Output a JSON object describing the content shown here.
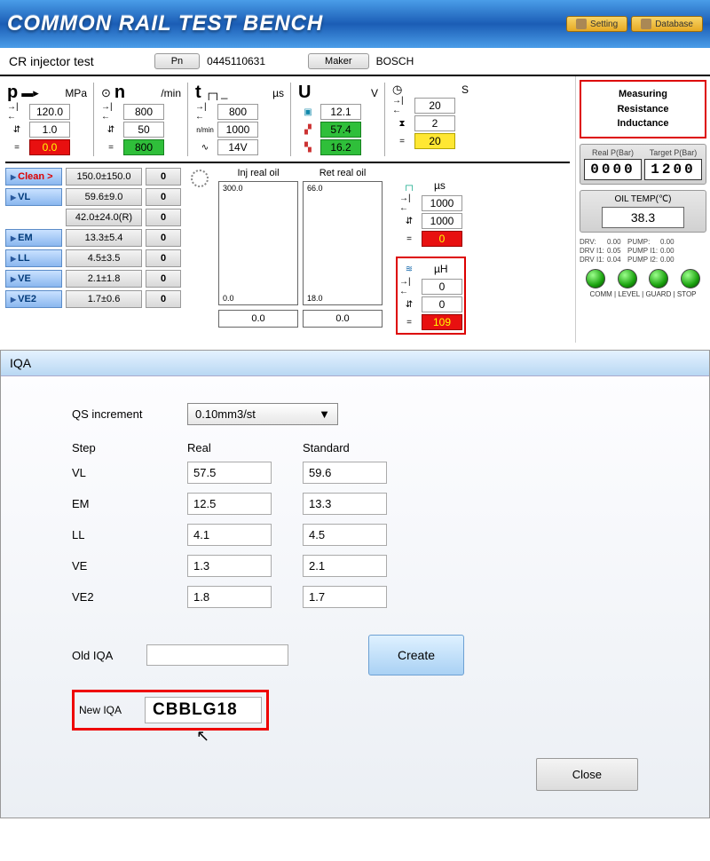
{
  "topbar": {
    "title": "COMMON RAIL TEST BENCH",
    "setting": "Setting",
    "database": "Database"
  },
  "sub": {
    "title": "CR injector test",
    "pn_label": "Pn",
    "pn_value": "0445110631",
    "maker_label": "Maker",
    "maker_value": "BOSCH"
  },
  "p": {
    "sym": "p",
    "unit": "MPa",
    "r1": "120.0",
    "r2": "1.0",
    "r3": "0.0"
  },
  "n": {
    "sym": "n",
    "unit": "/min",
    "r1": "800",
    "r2": "50",
    "r3": "800"
  },
  "t": {
    "sym": "t",
    "unit": "µs",
    "r1": "800",
    "r2": "1000",
    "r3": "14V"
  },
  "u": {
    "sym": "U",
    "unit": "V",
    "r1": "12.1",
    "r2": "57.4",
    "r3": "16.2"
  },
  "s": {
    "unit": "S",
    "r1": "20",
    "r2": "2",
    "r3": "20"
  },
  "steps": [
    {
      "name": "Clean >",
      "v1": "150.0±150.0",
      "v2": "0",
      "red": true
    },
    {
      "name": "VL",
      "v1": "59.6±9.0",
      "v2": "0"
    },
    {
      "name": "",
      "v1": "42.0±24.0(R)",
      "v2": "0",
      "blank": true
    },
    {
      "name": "EM",
      "v1": "13.3±5.4",
      "v2": "0"
    },
    {
      "name": "LL",
      "v1": "4.5±3.5",
      "v2": "0"
    },
    {
      "name": "VE",
      "v1": "2.1±1.8",
      "v2": "0"
    },
    {
      "name": "VE2",
      "v1": "1.7±0.6",
      "v2": "0"
    }
  ],
  "oil_inj": {
    "title": "Inj real oil",
    "top": "300.0",
    "bot": "0.0",
    "val": "0.0"
  },
  "oil_ret": {
    "title": "Ret real oil",
    "top": "66.0",
    "bot": "18.0",
    "val": "0.0"
  },
  "us_block": {
    "unit": "µs",
    "r1": "1000",
    "r2": "1000",
    "r3": "0"
  },
  "uh_block": {
    "unit": "µH",
    "r1": "0",
    "r2": "0",
    "r3": "109"
  },
  "callout": {
    "l1": "Measuring",
    "l2": "Resistance",
    "l3": "Inductance"
  },
  "pressure": {
    "realLabel": "Real P(Bar)",
    "targetLabel": "Target P(Bar)",
    "real": "0000",
    "target": "1200"
  },
  "oiltemp": {
    "label": "OIL TEMP(℃)",
    "value": "38.3"
  },
  "stats": {
    "a1": "DRV:",
    "a2": "0.00",
    "a3": "PUMP:",
    "a4": "0.00",
    "b1": "DRV I1:",
    "b2": "0.05",
    "b3": "PUMP I1:",
    "b4": "0.00",
    "c1": "DRV I1:",
    "c2": "0.04",
    "c3": "PUMP I2:",
    "c4": "0.00"
  },
  "leds": "COMM | LEVEL | GUARD | STOP",
  "iqa": {
    "title": "IQA",
    "qs_label": "QS increment",
    "qs_value": "0.10mm3/st",
    "h_step": "Step",
    "h_real": "Real",
    "h_std": "Standard",
    "rows": [
      {
        "step": "VL",
        "real": "57.5",
        "std": "59.6"
      },
      {
        "step": "EM",
        "real": "12.5",
        "std": "13.3"
      },
      {
        "step": "LL",
        "real": "4.1",
        "std": "4.5"
      },
      {
        "step": "VE",
        "real": "1.3",
        "std": "2.1"
      },
      {
        "step": "VE2",
        "real": "1.8",
        "std": "1.7"
      }
    ],
    "old_label": "Old IQA",
    "old_value": "",
    "new_label": "New IQA",
    "new_value": "CBBLG18",
    "create": "Create",
    "close": "Close"
  }
}
